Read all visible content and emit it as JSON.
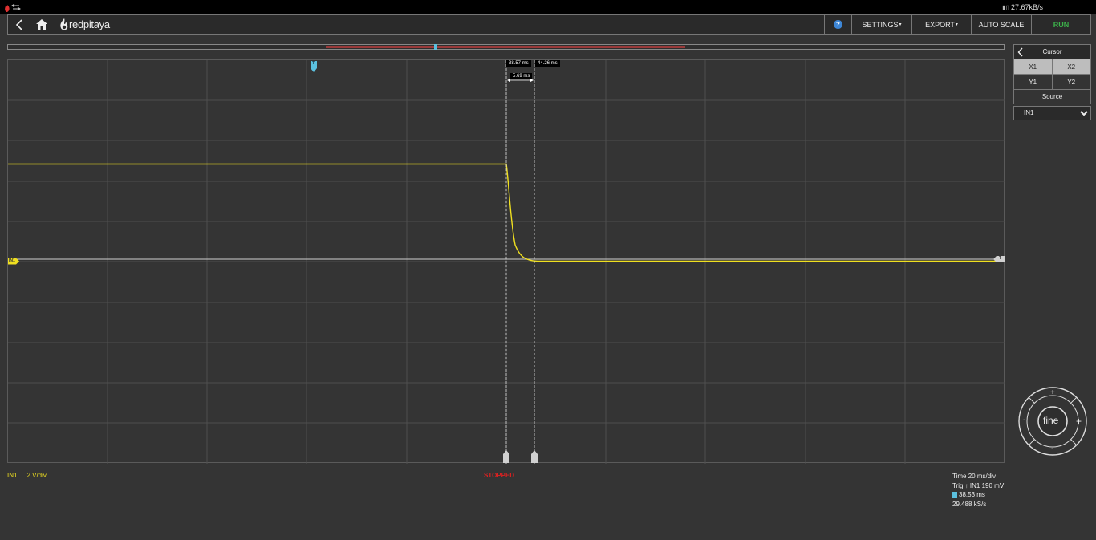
{
  "topbar": {
    "data_rate": "27.67kB/s"
  },
  "navbar": {
    "logo_text": "redpitaya",
    "help": "?",
    "settings_label": "SETTINGS",
    "export_label": "EXPORT",
    "autoscale_label": "AUTO SCALE",
    "run_label": "RUN",
    "run_color": "#3cb44b"
  },
  "cursors": {
    "x1_label": "38.57 ms",
    "x2_label": "44.26 ms",
    "delta_label": "5.69 ms"
  },
  "panel": {
    "title": "Cursor",
    "buttons": [
      {
        "label": "X1",
        "active": true
      },
      {
        "label": "X2",
        "active": true
      },
      {
        "label": "Y1",
        "active": false
      },
      {
        "label": "Y2",
        "active": false
      }
    ],
    "source_title": "Source",
    "source_value": "IN1",
    "source_options": [
      "IN1"
    ]
  },
  "dial": {
    "center_label": "fine",
    "plus": "+",
    "minus": "-"
  },
  "plot": {
    "trigger_marker": "T",
    "channel_marker": "IN1",
    "trace_color": "#f0e020",
    "grid": true
  },
  "status": {
    "channel": "IN1",
    "scale": "2 V/div",
    "state": "STOPPED",
    "time_scale": "Time 20 ms/div",
    "trigger": "Trig ↑ IN1 190 mV",
    "trigger_position": "38.53 ms",
    "sample_rate": "29.488 kS/s"
  }
}
